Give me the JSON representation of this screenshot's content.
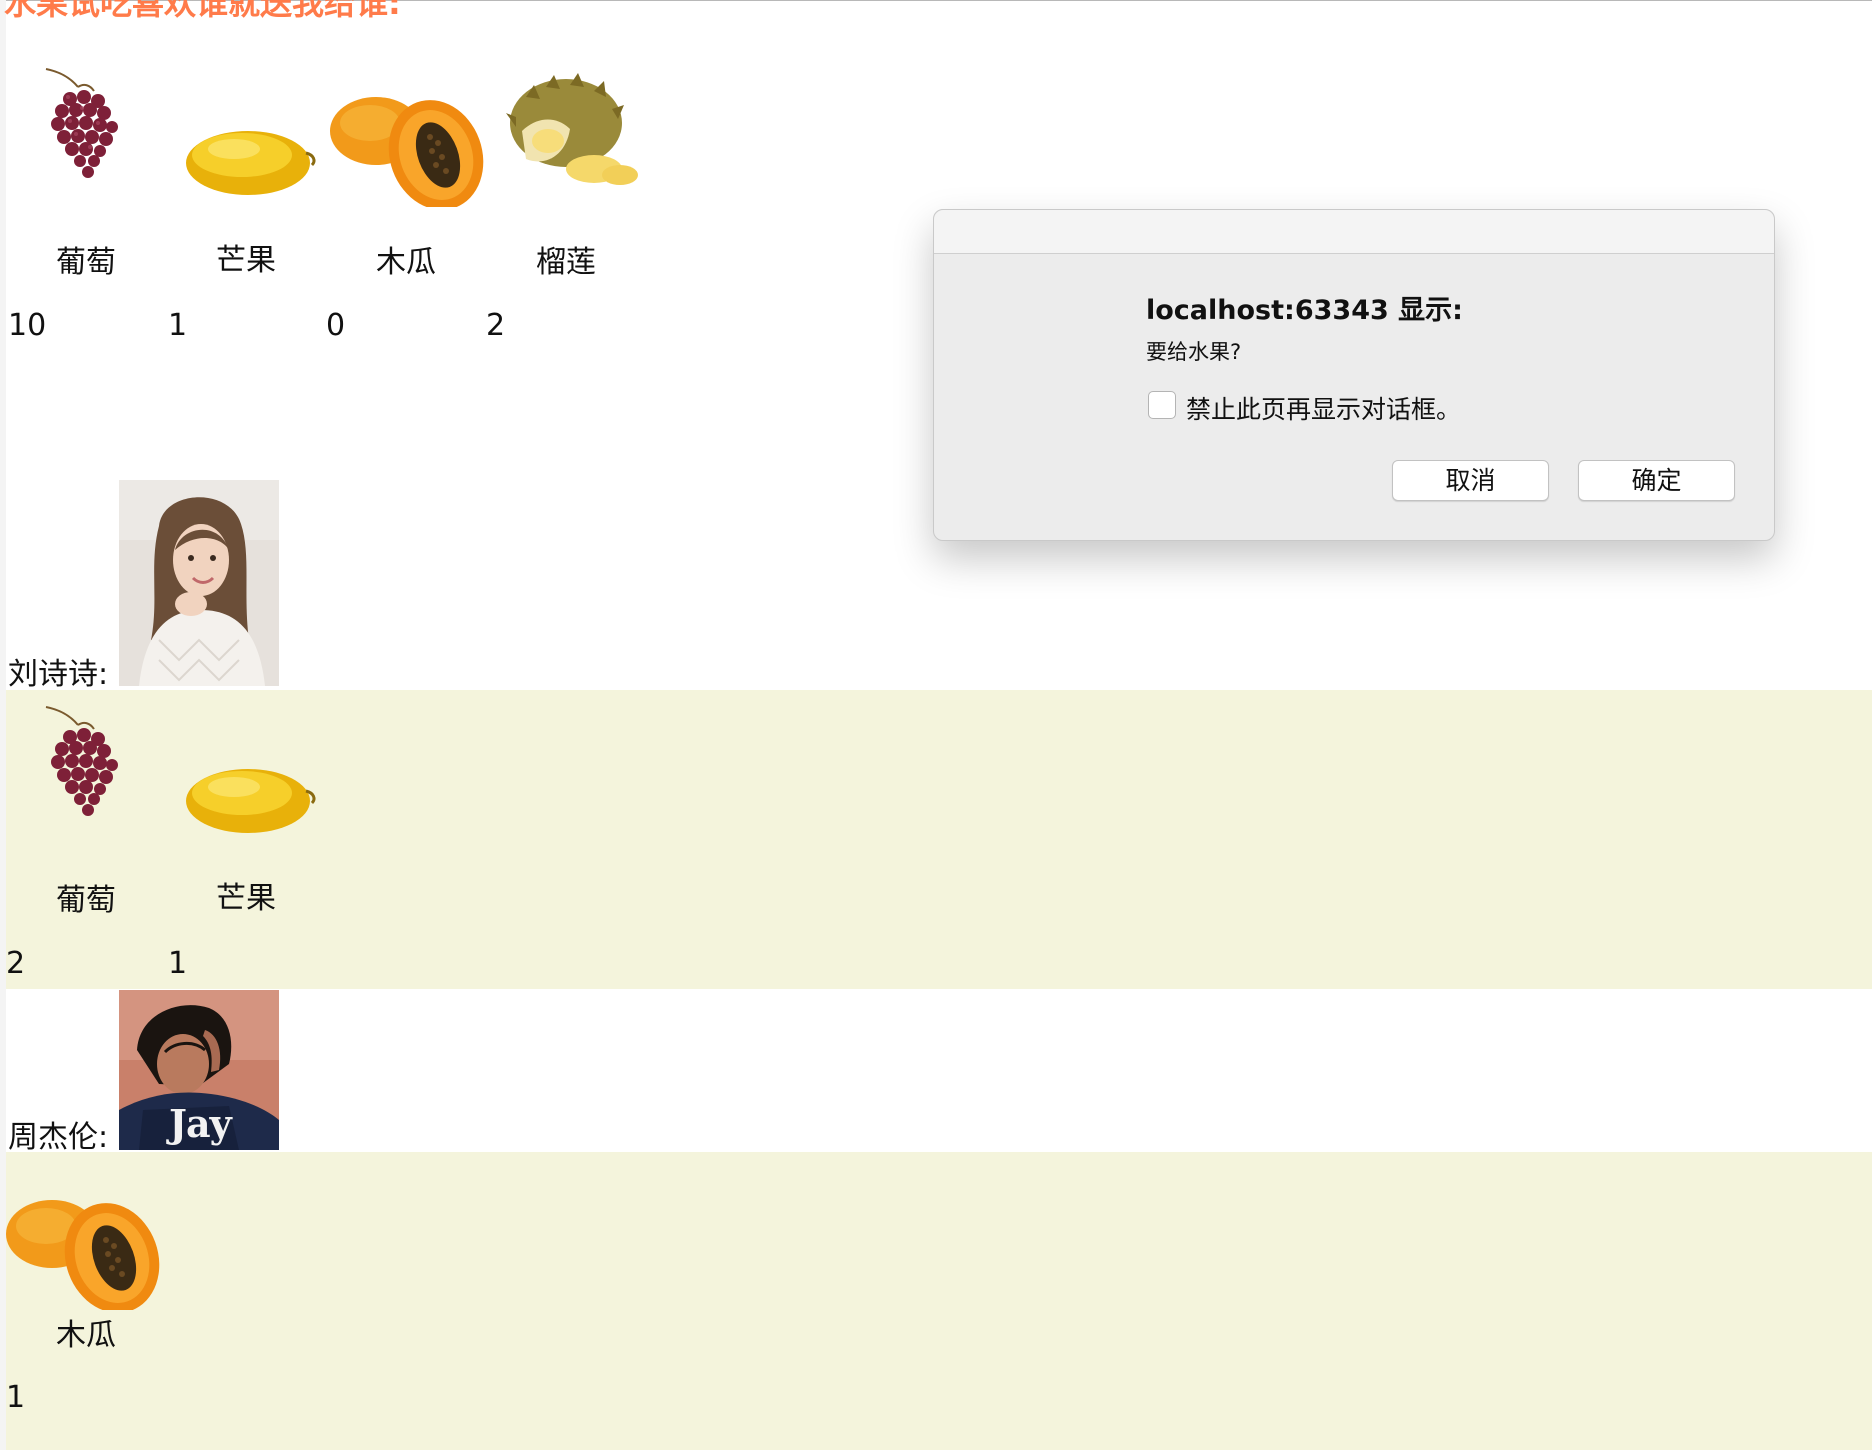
{
  "heading": "水果试吃喜欢谁就送我给谁:",
  "fruits": [
    {
      "name": "葡萄",
      "count": "10",
      "icon": "grape-icon"
    },
    {
      "name": "芒果",
      "count": "1",
      "icon": "mango-icon"
    },
    {
      "name": "木瓜",
      "count": "0",
      "icon": "papaya-icon"
    },
    {
      "name": "榴莲",
      "count": "2",
      "icon": "durian-icon"
    }
  ],
  "people": [
    {
      "label": "刘诗诗:",
      "fruits": [
        {
          "name": "葡萄",
          "count": "2"
        },
        {
          "name": "芒果",
          "count": "1"
        }
      ]
    },
    {
      "label": "周杰伦:",
      "fruits": [
        {
          "name": "木瓜",
          "count": "1"
        }
      ]
    }
  ],
  "album_text": "Jay",
  "dialog": {
    "title": "localhost:63343 显示:",
    "message": "要给水果?",
    "checkbox_label": "禁止此页再显示对话框。",
    "cancel_label": "取消",
    "ok_label": "确定"
  },
  "colors": {
    "heading": "#ff7b4a",
    "band": "#f4f4dc"
  }
}
